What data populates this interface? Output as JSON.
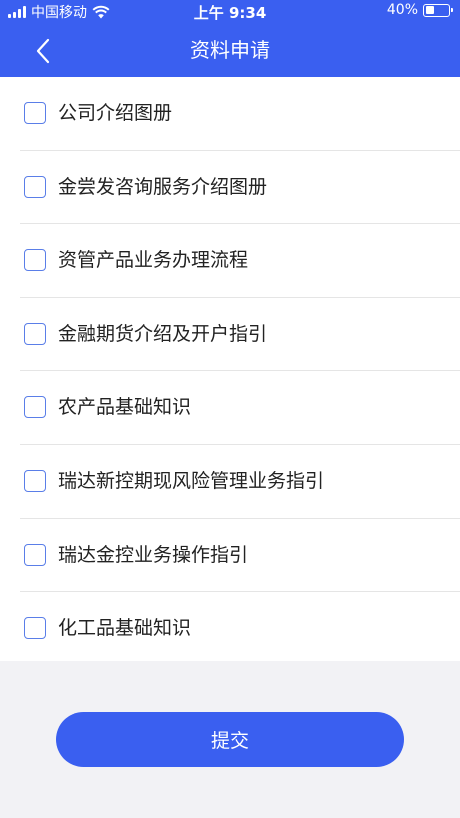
{
  "status_bar": {
    "carrier": "中国移动",
    "time": "上午 9:34",
    "battery": "40%",
    "battery_level": 0.4
  },
  "nav": {
    "title": "资料申请",
    "back_icon": "chevron-left-icon"
  },
  "items": [
    {
      "label": "公司介绍图册",
      "checked": false
    },
    {
      "label": "金尝发咨询服务介绍图册",
      "checked": false
    },
    {
      "label": "资管产品业务办理流程",
      "checked": false
    },
    {
      "label": "金融期货介绍及开户指引",
      "checked": false
    },
    {
      "label": "农产品基础知识",
      "checked": false
    },
    {
      "label": "瑞达新控期现风险管理业务指引",
      "checked": false
    },
    {
      "label": "瑞达金控业务操作指引",
      "checked": false
    },
    {
      "label": "化工品基础知识",
      "checked": false
    }
  ],
  "submit_label": "提交",
  "colors": {
    "primary": "#3a5ff0",
    "checkbox_border": "#5a7ee8",
    "background": "#f2f2f5"
  }
}
